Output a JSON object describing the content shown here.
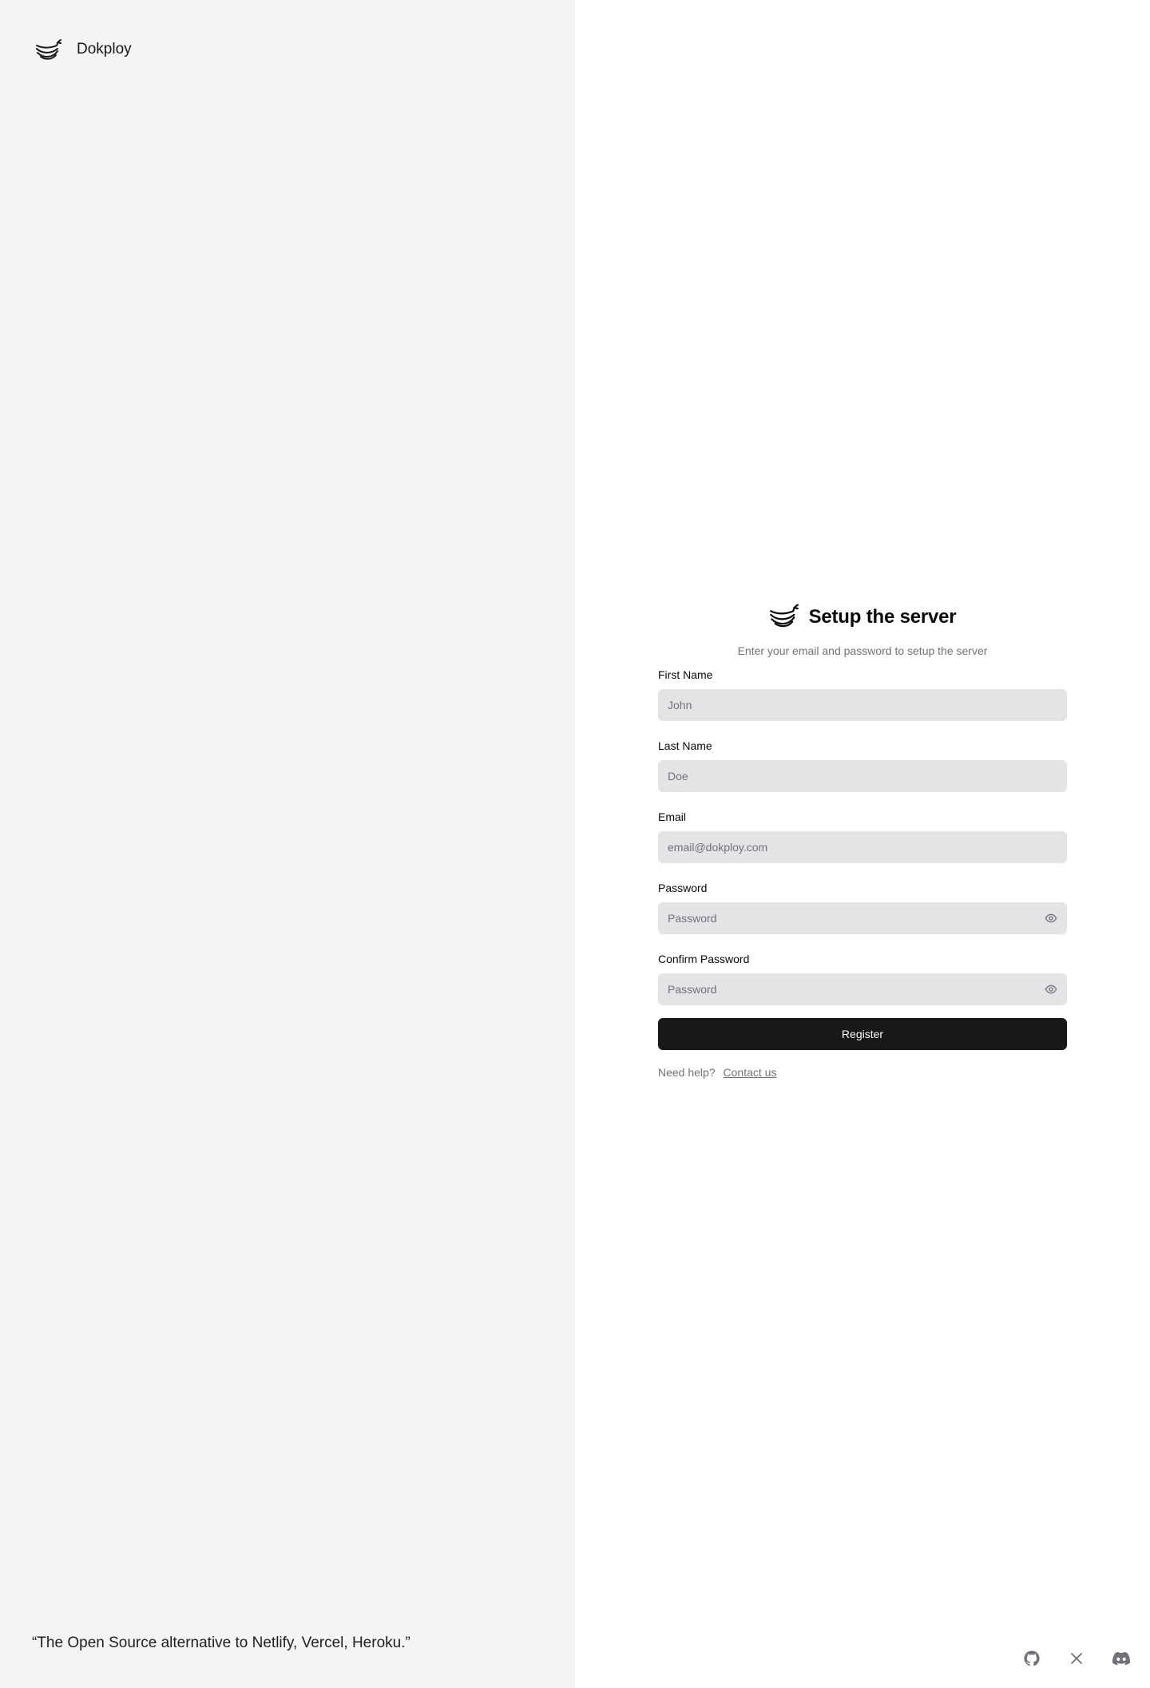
{
  "brand": {
    "name": "Dokploy",
    "icon": "dokploy-logo-icon"
  },
  "quote": "“The Open Source alternative to Netlify, Vercel, Heroku.”",
  "form": {
    "title": "Setup the server",
    "subtitle": "Enter your email and password to setup the server",
    "fields": {
      "first_name": {
        "label": "First Name",
        "placeholder": "John",
        "value": ""
      },
      "last_name": {
        "label": "Last Name",
        "placeholder": "Doe",
        "value": ""
      },
      "email": {
        "label": "Email",
        "placeholder": "email@dokploy.com",
        "value": ""
      },
      "password": {
        "label": "Password",
        "placeholder": "Password",
        "value": "",
        "icon": "eye-icon"
      },
      "confirm_password": {
        "label": "Confirm Password",
        "placeholder": "Password",
        "value": "",
        "icon": "eye-icon"
      }
    },
    "register_label": "Register",
    "help_text": "Need help?",
    "contact_label": "Contact us"
  },
  "socials": [
    "github-icon",
    "x-icon",
    "discord-icon"
  ],
  "colors": {
    "left_panel_bg": "#f4f4f4",
    "input_bg": "#e4e4e7",
    "button_bg": "#18181b",
    "muted_text": "#71717a"
  }
}
